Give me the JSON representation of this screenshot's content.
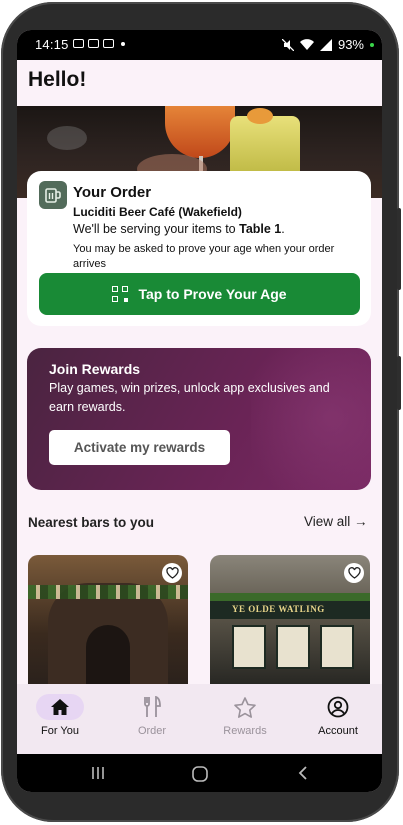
{
  "status_bar": {
    "time": "14:15",
    "battery": "93%"
  },
  "header": {
    "greeting": "Hello!"
  },
  "order_card": {
    "title": "Your Order",
    "venue": "Luciditi Beer Café (Wakefield)",
    "serving_prefix": "We'll be serving your items to ",
    "table": "Table 1",
    "serving_suffix": ".",
    "age_note": "You may be asked to prove your age when your order arrives",
    "prove_button": "Tap to Prove Your Age",
    "button_color": "#198a36"
  },
  "rewards": {
    "title": "Join Rewards",
    "subtitle": "Play games, win prizes, unlock app exclusives and earn rewards.",
    "button": "Activate my rewards"
  },
  "nearest": {
    "heading": "Nearest bars to you",
    "view_all": "View all →",
    "bars": [
      {
        "icon": "heart-icon",
        "sign": ""
      },
      {
        "icon": "heart-icon",
        "sign": "YE OLDE WATLING"
      }
    ]
  },
  "bottom_nav": [
    {
      "label": "For You",
      "icon": "home-icon",
      "active": true
    },
    {
      "label": "Order",
      "icon": "fork-knife-icon",
      "active": false
    },
    {
      "label": "Rewards",
      "icon": "star-icon",
      "active": false
    },
    {
      "label": "Account",
      "icon": "account-icon",
      "active": false
    }
  ]
}
